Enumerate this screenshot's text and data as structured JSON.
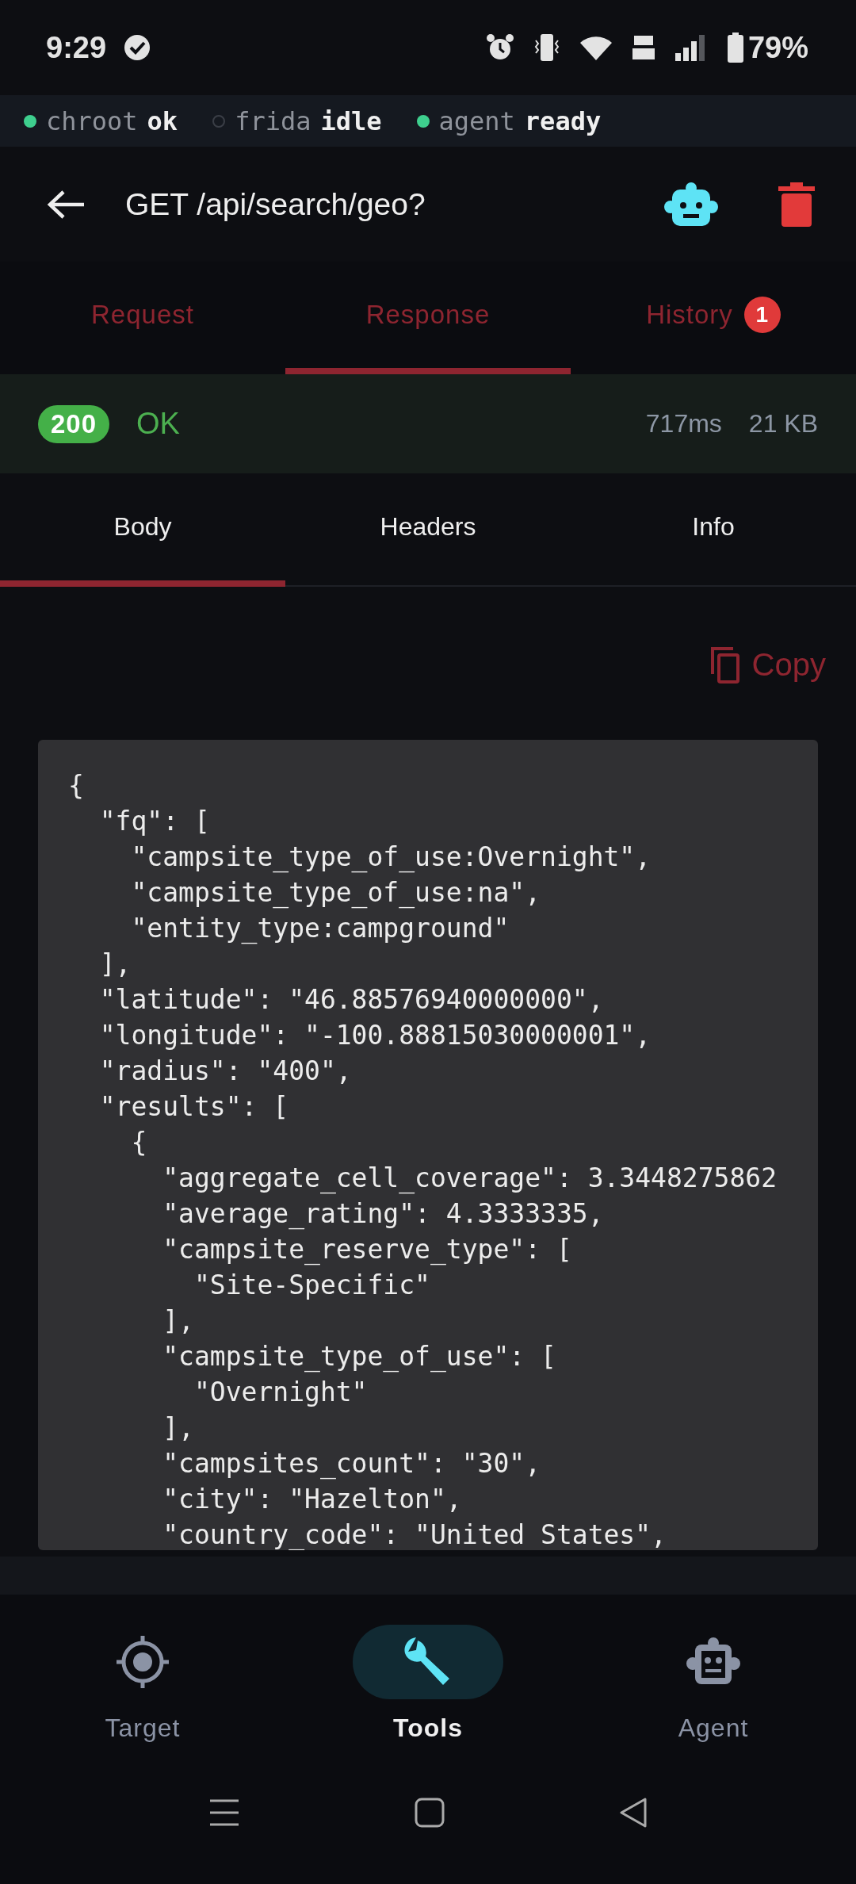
{
  "status_bar": {
    "time": "9:29",
    "battery": "79%"
  },
  "services": [
    {
      "name": "chroot",
      "state": "ok",
      "on": true
    },
    {
      "name": "frida",
      "state": "idle",
      "on": false
    },
    {
      "name": "agent",
      "state": "ready",
      "on": true
    }
  ],
  "header": {
    "title": "GET /api/search/geo?"
  },
  "tabs": [
    {
      "label": "Request",
      "selected": false
    },
    {
      "label": "Response",
      "selected": true
    },
    {
      "label": "History",
      "selected": false,
      "badge": "1"
    }
  ],
  "response": {
    "code": "200",
    "status": "OK",
    "time": "717ms",
    "size": "21 KB"
  },
  "subtabs": [
    {
      "label": "Body",
      "selected": true
    },
    {
      "label": "Headers",
      "selected": false
    },
    {
      "label": "Info",
      "selected": false
    }
  ],
  "copy_button": "Copy",
  "body_lines": [
    "{",
    "  \"fq\": [",
    "    \"campsite_type_of_use:Overnight\",",
    "    \"campsite_type_of_use:na\",",
    "    \"entity_type:campground\"",
    "  ],",
    "  \"latitude\": \"46.88576940000000\",",
    "  \"longitude\": \"-100.88815030000001\",",
    "  \"radius\": \"400\",",
    "  \"results\": [",
    "    {",
    "      \"aggregate_cell_coverage\": 3.3448275862",
    "      \"average_rating\": 4.3333335,",
    "      \"campsite_reserve_type\": [",
    "        \"Site-Specific\"",
    "      ],",
    "      \"campsite_type_of_use\": [",
    "        \"Overnight\"",
    "      ],",
    "      \"campsites_count\": \"30\",",
    "      \"city\": \"Hazelton\",",
    "      \"country_code\": \"United States\","
  ],
  "bottom_nav": [
    {
      "kind": "target",
      "label": "Target",
      "selected": false
    },
    {
      "kind": "tools",
      "label": "Tools",
      "selected": true
    },
    {
      "kind": "agent",
      "label": "Agent",
      "selected": false
    }
  ]
}
